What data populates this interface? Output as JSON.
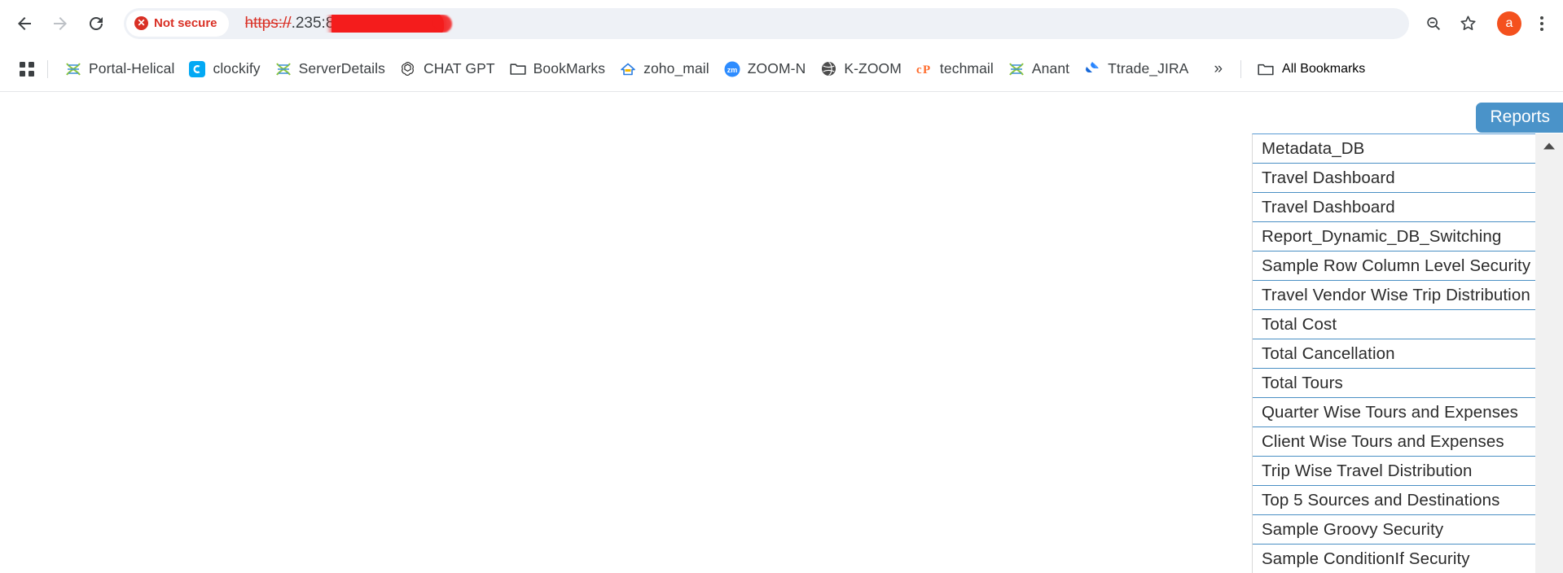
{
  "browser": {
    "nav": {
      "back_label": "Back",
      "forward_label": "Forward",
      "reload_label": "Reload"
    },
    "omnibox": {
      "security_badge": "×",
      "security_text": "Not secure",
      "url_scheme": "https://",
      "url_rest": ".235:8443/sso/#/",
      "redacted": true
    },
    "toolbar_right": {
      "zoom_out_icon": "zoom-out-icon",
      "bookmark_star_icon": "star-icon",
      "avatar_initial": "a",
      "menu_icon": "kebab-menu-icon"
    }
  },
  "bookmarks_bar": {
    "apps_icon": "apps-grid-icon",
    "items": [
      {
        "label": "Portal-Helical",
        "icon": "dna-icon"
      },
      {
        "label": "clockify",
        "icon": "clockify-icon"
      },
      {
        "label": "ServerDetails",
        "icon": "dna-icon"
      },
      {
        "label": "CHAT GPT",
        "icon": "openai-icon"
      },
      {
        "label": "BookMarks",
        "icon": "folder-icon"
      },
      {
        "label": "zoho_mail",
        "icon": "zoho-icon"
      },
      {
        "label": "ZOOM-N",
        "icon": "zoom-icon"
      },
      {
        "label": "K-ZOOM",
        "icon": "globe-icon"
      },
      {
        "label": "techmail",
        "icon": "cpanel-icon"
      },
      {
        "label": "Anant",
        "icon": "dna-icon"
      },
      {
        "label": "Ttrade_JIRA",
        "icon": "jira-icon"
      }
    ],
    "overflow_label": "»",
    "all_bookmarks_label": "All Bookmarks",
    "all_bookmarks_icon": "folder-icon"
  },
  "page": {
    "reports_tab": {
      "label": "Reports",
      "color": "#4a93c9"
    },
    "reports_list": {
      "items": [
        "Metadata_DB",
        "Travel Dashboard",
        "Travel Dashboard",
        "Report_Dynamic_DB_Switching",
        "Sample Row Column Level Security",
        "Travel Vendor Wise Trip Distribution",
        "Total Cost",
        "Total Cancellation",
        "Total Tours",
        "Quarter Wise Tours and Expenses",
        "Client Wise Tours and Expenses",
        "Trip Wise Travel Distribution",
        "Top 5 Sources and Destinations",
        "Sample Groovy Security",
        "Sample ConditionIf Security"
      ],
      "scroll_up_icon": "scroll-up-arrow-icon",
      "separator_color": "#4a8fc4"
    }
  }
}
